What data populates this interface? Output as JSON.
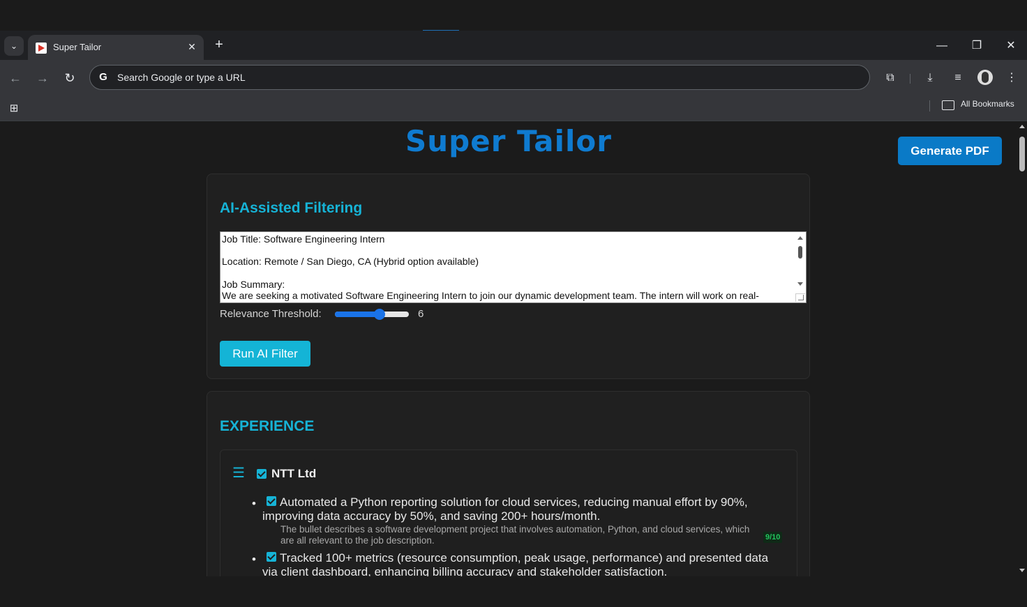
{
  "browser": {
    "tab_title": "Super Tailor",
    "tab_close": "✕",
    "new_tab": "+",
    "omnibox_placeholder": "Search Google or type a URL",
    "bookmarks_label": "All Bookmarks",
    "window_controls": {
      "minimize": "—",
      "restore": "❐",
      "close": "✕"
    }
  },
  "app": {
    "title": "Super Tailor",
    "generate_pdf_label": "Generate PDF",
    "brand_color": "#0f7bd0",
    "accent_color": "#16b3d6"
  },
  "ai_filter": {
    "heading": "AI-Assisted Filtering",
    "job_description": "Job Title: Software Engineering Intern\n\nLocation: Remote / San Diego, CA (Hybrid option available)\n\nJob Summary:\nWe are seeking a motivated Software Engineering Intern to join our dynamic development team. The intern will work on real-",
    "threshold_label": "Relevance Threshold:",
    "threshold_value": "6",
    "threshold_min": 0,
    "threshold_max": 10,
    "run_label": "Run AI Filter"
  },
  "experience": {
    "heading": "EXPERIENCE",
    "jobs": [
      {
        "company": "NTT Ltd",
        "checked": true,
        "bullets": [
          {
            "text": "Automated a Python reporting solution for cloud services, reducing manual effort by 90%, improving data accuracy by 50%, and saving 200+ hours/month.",
            "checked": true,
            "reason": "The bullet describes a software development project that involves automation, Python, and cloud services, which are all relevant to the job description.",
            "score": "9/10"
          },
          {
            "text": "Tracked 100+ metrics (resource consumption, peak usage, performance) and presented data via client dashboard, enhancing billing accuracy and stakeholder satisfaction.",
            "checked": true
          }
        ]
      }
    ]
  },
  "icons": {
    "tab_search": "chevron-down-icon",
    "back": "arrow-left-icon",
    "forward": "arrow-right-icon",
    "reload": "reload-icon",
    "extensions": "puzzle-icon",
    "downloads": "download-icon",
    "media": "media-queue-icon",
    "menu": "kebab-menu-icon",
    "drag": "drag-handle-icon"
  }
}
